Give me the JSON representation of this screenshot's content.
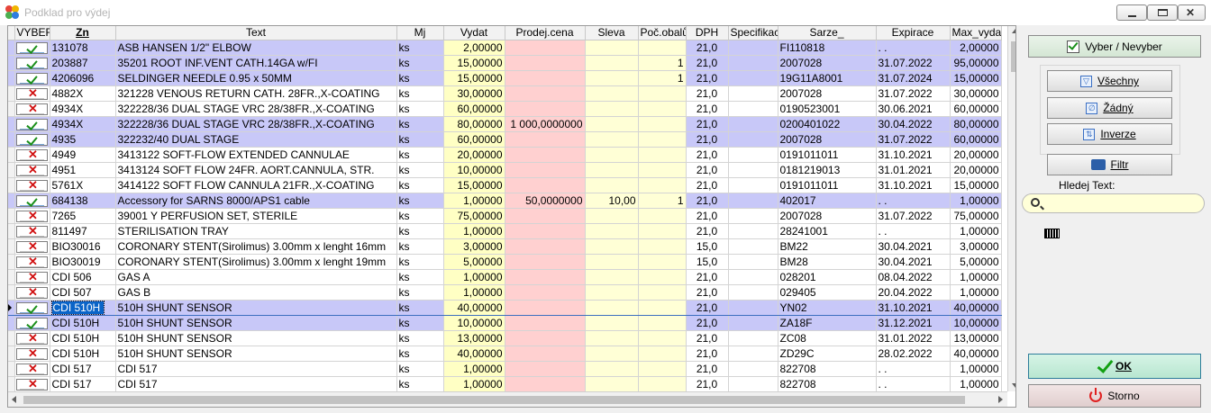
{
  "window": {
    "title": "Podklad pro výdej"
  },
  "columns": [
    "VYBER",
    "Zn",
    "Text",
    "Mj",
    "Vydat",
    "Prodej.cena",
    "Sleva",
    "Poč.obalů",
    "DPH",
    "Specifikac",
    "Sarze_",
    "Expirace",
    "Max_vydat"
  ],
  "rows": [
    {
      "sel": true,
      "zn": "131078",
      "text": "ASB HANSEN 1/2\" ELBOW",
      "mj": "ks",
      "vydat": "2,00000",
      "prodej": "",
      "sleva": "",
      "poc": "",
      "dph": "21,0",
      "spec": "",
      "sarze": "FI110818",
      "expirace": ". .",
      "max": "2,00000"
    },
    {
      "sel": true,
      "zn": "203887",
      "text": "35201 ROOT INF.VENT CATH.14GA w/FI",
      "mj": "ks",
      "vydat": "15,00000",
      "prodej": "",
      "sleva": "",
      "poc": "1",
      "dph": "21,0",
      "spec": "",
      "sarze": "2007028",
      "expirace": "31.07.2022",
      "max": "95,00000"
    },
    {
      "sel": true,
      "zn": "4206096",
      "text": "SELDINGER NEEDLE 0.95 x 50MM",
      "mj": "ks",
      "vydat": "15,00000",
      "prodej": "",
      "sleva": "",
      "poc": "1",
      "dph": "21,0",
      "spec": "",
      "sarze": "19G11A8001",
      "expirace": "31.07.2024",
      "max": "15,00000"
    },
    {
      "sel": false,
      "zn": "4882X",
      "text": "321228 VENOUS RETURN CATH. 28FR.,X-COATING",
      "mj": "ks",
      "vydat": "30,00000",
      "prodej": "",
      "sleva": "",
      "poc": "",
      "dph": "21,0",
      "spec": "",
      "sarze": "2007028",
      "expirace": "31.07.2022",
      "max": "30,00000"
    },
    {
      "sel": false,
      "zn": "4934X",
      "text": "322228/36 DUAL STAGE VRC 28/38FR.,X-COATING",
      "mj": "ks",
      "vydat": "60,00000",
      "prodej": "",
      "sleva": "",
      "poc": "",
      "dph": "21,0",
      "spec": "",
      "sarze": "0190523001",
      "expirace": "30.06.2021",
      "max": "60,00000"
    },
    {
      "sel": true,
      "zn": "4934X",
      "text": "322228/36 DUAL STAGE VRC 28/38FR.,X-COATING",
      "mj": "ks",
      "vydat": "80,00000",
      "prodej": "1 000,0000000",
      "sleva": "",
      "poc": "",
      "dph": "21,0",
      "spec": "",
      "sarze": "0200401022",
      "expirace": "30.04.2022",
      "max": "80,00000"
    },
    {
      "sel": true,
      "zn": "4935",
      "text": "322232/40 DUAL STAGE",
      "mj": "ks",
      "vydat": "60,00000",
      "prodej": "",
      "sleva": "",
      "poc": "",
      "dph": "21,0",
      "spec": "",
      "sarze": "2007028",
      "expirace": "31.07.2022",
      "max": "60,00000"
    },
    {
      "sel": false,
      "zn": "4949",
      "text": "3413122 SOFT-FLOW EXTENDED CANNULAE",
      "mj": "ks",
      "vydat": "20,00000",
      "prodej": "",
      "sleva": "",
      "poc": "",
      "dph": "21,0",
      "spec": "",
      "sarze": "0191011011",
      "expirace": "31.10.2021",
      "max": "20,00000"
    },
    {
      "sel": false,
      "zn": "4951",
      "text": "3413124 SOFT FLOW 24FR. AORT.CANNULA, STR.",
      "mj": "ks",
      "vydat": "10,00000",
      "prodej": "",
      "sleva": "",
      "poc": "",
      "dph": "21,0",
      "spec": "",
      "sarze": "0181219013",
      "expirace": "31.01.2021",
      "max": "20,00000"
    },
    {
      "sel": false,
      "zn": "5761X",
      "text": "3414122 SOFT FLOW CANNULA 21FR.,X-COATING",
      "mj": "ks",
      "vydat": "15,00000",
      "prodej": "",
      "sleva": "",
      "poc": "",
      "dph": "21,0",
      "spec": "",
      "sarze": "0191011011",
      "expirace": "31.10.2021",
      "max": "15,00000"
    },
    {
      "sel": true,
      "zn": "684138",
      "text": "Accessory for SARNS 8000/APS1 cable",
      "mj": "ks",
      "vydat": "1,00000",
      "prodej": "50,0000000",
      "sleva": "10,00",
      "poc": "1",
      "dph": "21,0",
      "spec": "",
      "sarze": "402017",
      "expirace": ". .",
      "max": "1,00000"
    },
    {
      "sel": false,
      "zn": "7265",
      "text": "39001  Y PERFUSION SET, STERILE",
      "mj": "ks",
      "vydat": "75,00000",
      "prodej": "",
      "sleva": "",
      "poc": "",
      "dph": "21,0",
      "spec": "",
      "sarze": "2007028",
      "expirace": "31.07.2022",
      "max": "75,00000"
    },
    {
      "sel": false,
      "zn": "811497",
      "text": "STERILISATION TRAY",
      "mj": "ks",
      "vydat": "1,00000",
      "prodej": "",
      "sleva": "",
      "poc": "",
      "dph": "21,0",
      "spec": "",
      "sarze": "28241001",
      "expirace": ". .",
      "max": "1,00000"
    },
    {
      "sel": false,
      "zn": "BIO30016",
      "text": "CORONARY STENT(Sirolimus) 3.00mm x lenght 16mm",
      "mj": "ks",
      "vydat": "3,00000",
      "prodej": "",
      "sleva": "",
      "poc": "",
      "dph": "15,0",
      "spec": "",
      "sarze": "BM22",
      "expirace": "30.04.2021",
      "max": "3,00000"
    },
    {
      "sel": false,
      "zn": "BIO30019",
      "text": "CORONARY STENT(Sirolimus) 3.00mm x lenght 19mm",
      "mj": "ks",
      "vydat": "5,00000",
      "prodej": "",
      "sleva": "",
      "poc": "",
      "dph": "15,0",
      "spec": "",
      "sarze": "BM28",
      "expirace": "30.04.2021",
      "max": "5,00000"
    },
    {
      "sel": false,
      "zn": "CDI 506",
      "text": "GAS A",
      "mj": "ks",
      "vydat": "1,00000",
      "prodej": "",
      "sleva": "",
      "poc": "",
      "dph": "21,0",
      "spec": "",
      "sarze": "028201",
      "expirace": "08.04.2022",
      "max": "1,00000"
    },
    {
      "sel": false,
      "zn": "CDI 507",
      "text": "GAS B",
      "mj": "ks",
      "vydat": "1,00000",
      "prodej": "",
      "sleva": "",
      "poc": "",
      "dph": "21,0",
      "spec": "",
      "sarze": "029405",
      "expirace": "20.04.2022",
      "max": "1,00000"
    },
    {
      "sel": true,
      "zn": "CDI 510H",
      "text": "510H SHUNT SENSOR",
      "mj": "ks",
      "vydat": "40,00000",
      "prodej": "",
      "sleva": "",
      "poc": "",
      "dph": "21,0",
      "spec": "",
      "sarze": "YN02",
      "expirace": "31.10.2021",
      "max": "40,00000",
      "current": true
    },
    {
      "sel": true,
      "zn": "CDI 510H",
      "text": "510H SHUNT SENSOR",
      "mj": "ks",
      "vydat": "10,00000",
      "prodej": "",
      "sleva": "",
      "poc": "",
      "dph": "21,0",
      "spec": "",
      "sarze": "ZA18F",
      "expirace": "31.12.2021",
      "max": "10,00000"
    },
    {
      "sel": false,
      "zn": "CDI 510H",
      "text": "510H SHUNT SENSOR",
      "mj": "ks",
      "vydat": "13,00000",
      "prodej": "",
      "sleva": "",
      "poc": "",
      "dph": "21,0",
      "spec": "",
      "sarze": "ZC08",
      "expirace": "31.01.2022",
      "max": "13,00000"
    },
    {
      "sel": false,
      "zn": "CDI 510H",
      "text": "510H SHUNT SENSOR",
      "mj": "ks",
      "vydat": "40,00000",
      "prodej": "",
      "sleva": "",
      "poc": "",
      "dph": "21,0",
      "spec": "",
      "sarze": "ZD29C",
      "expirace": "28.02.2022",
      "max": "40,00000"
    },
    {
      "sel": false,
      "zn": "CDI 517",
      "text": "CDI 517",
      "mj": "ks",
      "vydat": "1,00000",
      "prodej": "",
      "sleva": "",
      "poc": "",
      "dph": "21,0",
      "spec": "",
      "sarze": "822708",
      "expirace": ". .",
      "max": "1,00000"
    },
    {
      "sel": false,
      "zn": "CDI 517",
      "text": "CDI 517",
      "mj": "ks",
      "vydat": "1,00000",
      "prodej": "",
      "sleva": "",
      "poc": "",
      "dph": "21,0",
      "spec": "",
      "sarze": "822708",
      "expirace": ". .",
      "max": "1,00000"
    }
  ],
  "panel": {
    "vyber_label": "Vyber / Nevyber",
    "vsechny_label": "Všechny",
    "zadny_label": "Žádný",
    "inverze_label": "Inverze",
    "filtr_label": "Filtr",
    "hledej_label": "Hledej Text:",
    "search_value": "",
    "ok_label": "OK",
    "storno_label": "Storno"
  },
  "colors": {
    "selected_row": "#c8c8f8",
    "vydat_col": "#ffffc4",
    "prodej_col": "#ffd0d0",
    "sleva_col": "#ffffd6"
  }
}
